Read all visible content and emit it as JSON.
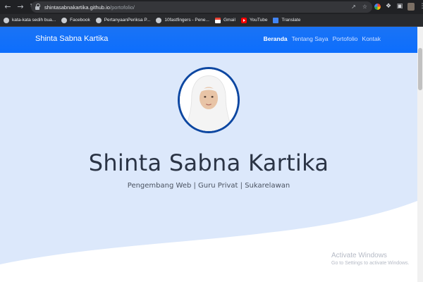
{
  "browser": {
    "url_host": "shintasabnakartika.github.io",
    "url_path": "/portofolio/",
    "bookmarks": [
      {
        "label": "kata-kata sedih bua...",
        "icon": "globe-icon"
      },
      {
        "label": "Facebook",
        "icon": "globe-icon"
      },
      {
        "label": "PertanyaanPeriksa P...",
        "icon": "globe-icon"
      },
      {
        "label": "10fastfingers - Pene...",
        "icon": "globe-icon"
      },
      {
        "label": "Gmail",
        "icon": "gmail-icon"
      },
      {
        "label": "YouTube",
        "icon": "youtube-icon"
      },
      {
        "label": "Translate",
        "icon": "translate-icon"
      }
    ]
  },
  "navbar": {
    "brand": "Shinta Sabna Kartika",
    "items": [
      {
        "label": "Beranda",
        "active": true
      },
      {
        "label": "Tentang Saya",
        "active": false
      },
      {
        "label": "Portofolio",
        "active": false
      },
      {
        "label": "Kontak",
        "active": false
      }
    ]
  },
  "hero": {
    "name": "Shinta Sabna Kartika",
    "tagline": "Pengembang Web | Guru Privat | Sukarelawan"
  },
  "watermark": {
    "line1": "Activate Windows",
    "line2": "Go to Settings to activate Windows."
  },
  "colors": {
    "navbar": "#0d6efd",
    "hero_bg": "#dce8fb",
    "photo_border": "#0d47a1"
  }
}
